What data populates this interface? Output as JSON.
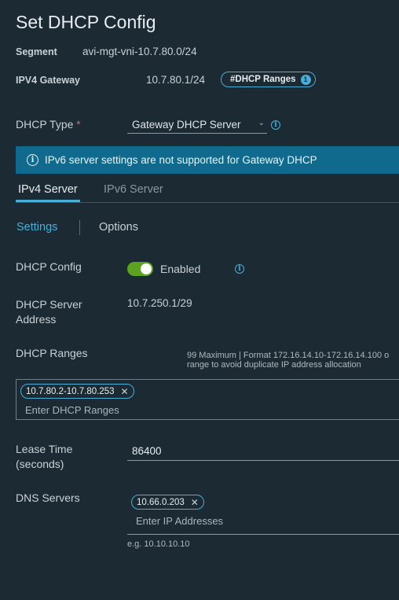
{
  "title": "Set DHCP Config",
  "segment": {
    "label": "Segment",
    "value": "avi-mgt-vni-10.7.80.0/24"
  },
  "gateway": {
    "label": "IPV4 Gateway",
    "value": "10.7.80.1/24",
    "ranges_button": "#DHCP Ranges",
    "ranges_count": "1"
  },
  "dhcp_type": {
    "label": "DHCP Type",
    "required_mark": "*",
    "selected": "Gateway DHCP Server"
  },
  "banner": {
    "text": "IPv6 server settings are not supported for Gateway DHCP"
  },
  "tabs": [
    {
      "label": "IPv4 Server"
    },
    {
      "label": "IPv6 Server"
    }
  ],
  "subtabs": [
    {
      "label": "Settings"
    },
    {
      "label": "Options"
    }
  ],
  "dhcp_config": {
    "label": "DHCP Config",
    "toggle_label": "Enabled",
    "enabled": true
  },
  "server_address": {
    "label_line1": "DHCP Server",
    "label_line2": "Address",
    "value": "10.7.250.1/29"
  },
  "dhcp_ranges": {
    "label": "DHCP Ranges",
    "hint_line1": "99 Maximum | Format 172.16.14.10-172.16.14.100 o",
    "hint_line2": "range to avoid duplicate IP address allocation",
    "chip": "10.7.80.2-10.7.80.253",
    "placeholder": "Enter DHCP Ranges"
  },
  "lease_time": {
    "label_line1": "Lease Time",
    "label_line2": "(seconds)",
    "value": "86400"
  },
  "dns": {
    "label": "DNS Servers",
    "chip": "10.66.0.203",
    "placeholder": "Enter IP Addresses",
    "example": "e.g. 10.10.10.10"
  },
  "colors": {
    "accent": "#49afd9",
    "background": "#1c2a33",
    "banner": "#0f6a8e",
    "toggle_on": "#5aa220",
    "required": "#e15d5d"
  }
}
